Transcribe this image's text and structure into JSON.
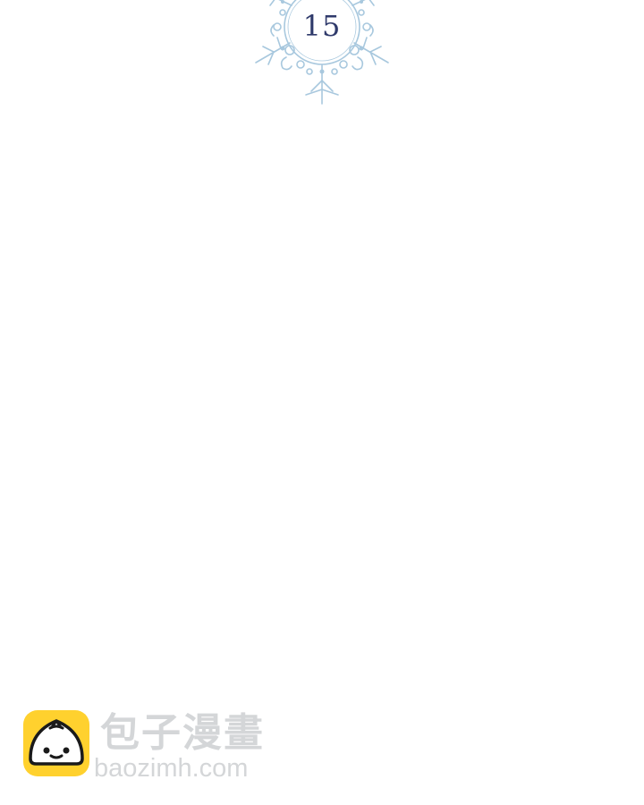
{
  "chapter": {
    "number": "15",
    "emblem_icon": "snowflake-frame-icon",
    "number_color": "#2f3a6b",
    "emblem_color": "#a8c8de"
  },
  "watermark": {
    "logo_icon": "steamed-bun-logo-icon",
    "title": "包子漫畫",
    "url": "baozimh.com",
    "text_color": "#d4d6d8",
    "logo_bg_color": "#ffd12e"
  }
}
